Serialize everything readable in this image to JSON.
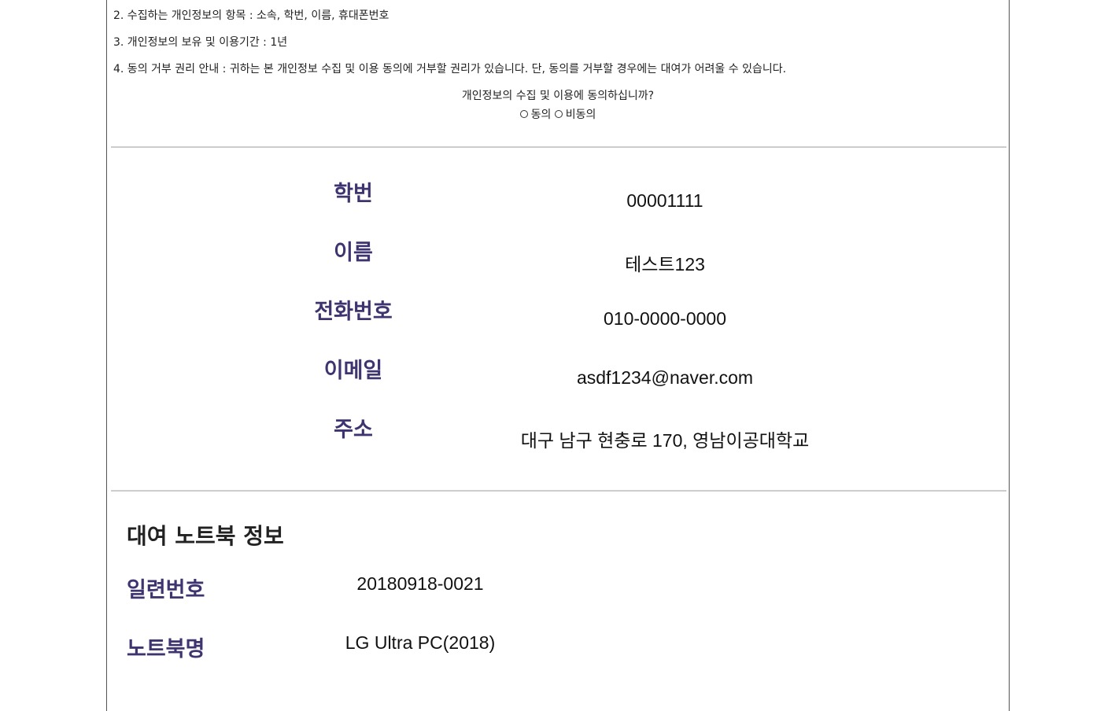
{
  "terms": {
    "item2": "2. 수집하는 개인정보의 항목 : 소속, 학번, 이름, 휴대폰번호",
    "item3": "3. 개인정보의 보유 및 이용기간 : 1년",
    "item4": "4. 동의 거부 권리 안내 : 귀하는 본 개인정보 수집 및 이용 동의에 거부할 권리가 있습니다. 단, 동의를 거부할 경우에는 대여가 어려울 수 있습니다."
  },
  "consent": {
    "question": "개인정보의 수집 및 이용에 동의하십니까?",
    "agree_label": "동의",
    "disagree_label": "비동의"
  },
  "user_info": {
    "student_id_label": "학번",
    "student_id": "00001111",
    "name_label": "이름",
    "name": "테스트123",
    "phone_label": "전화번호",
    "phone": "010-0000-0000",
    "email_label": "이메일",
    "email": "asdf1234@naver.com",
    "address_label": "주소",
    "address": "대구 남구 현충로 170, 영남이공대학교"
  },
  "notebook": {
    "section_title": "대여 노트북 정보",
    "serial_label": "일련번호",
    "serial": "20180918-0021",
    "model_label": "노트북명",
    "model": "LG Ultra PC(2018)"
  }
}
